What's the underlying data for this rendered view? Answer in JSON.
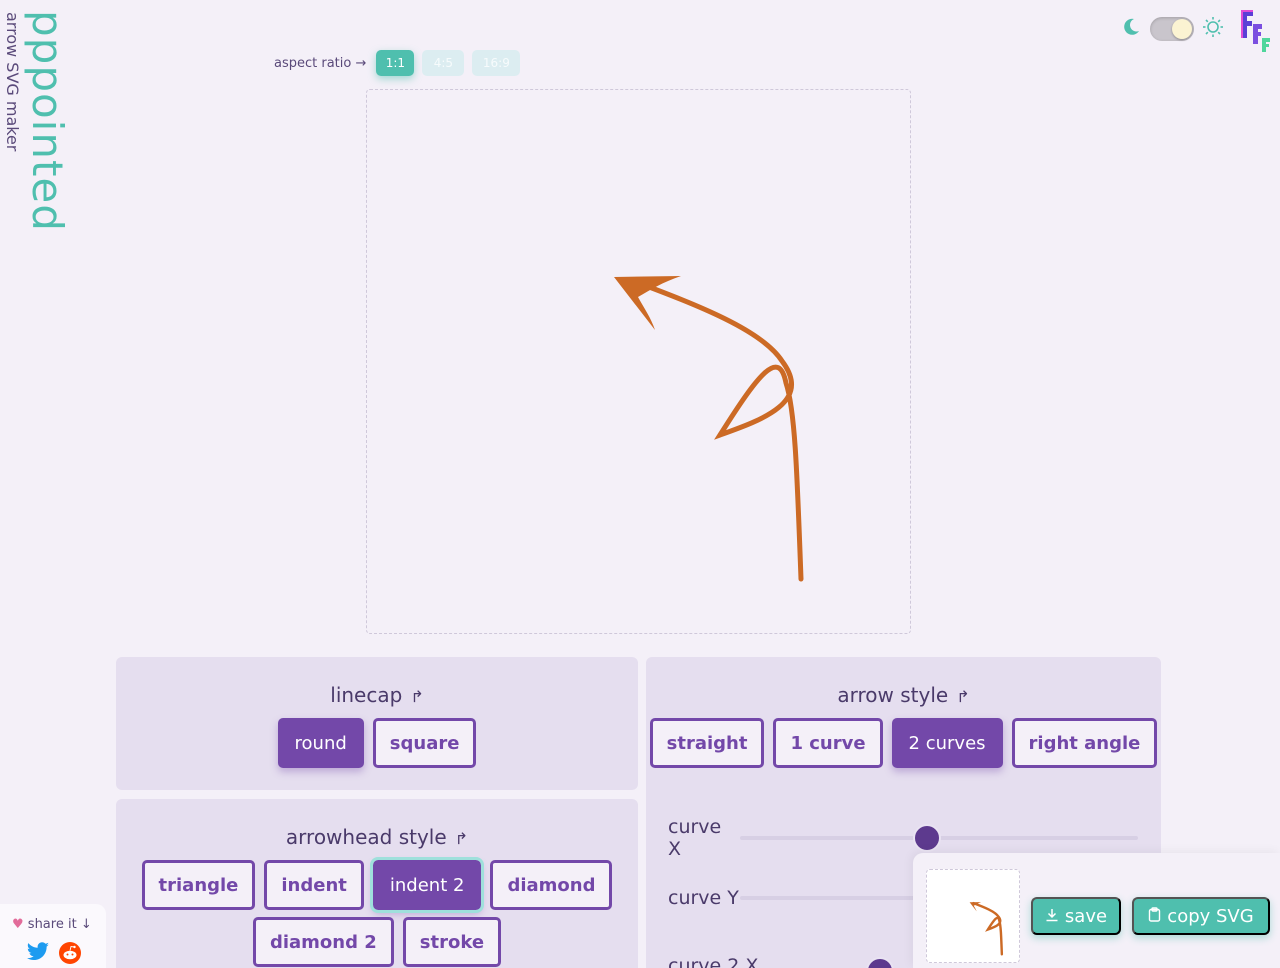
{
  "brand": {
    "title": "pppointed",
    "subtitle": "arrow SVG maker"
  },
  "aspect": {
    "label": "aspect ratio →",
    "options": [
      {
        "label": "1:1",
        "selected": true
      },
      {
        "label": "4:5",
        "selected": false
      },
      {
        "label": "16:9",
        "selected": false
      }
    ]
  },
  "theme": {
    "moon_icon": "moon-icon",
    "sun_icon": "sun-icon",
    "mode": "light"
  },
  "linecap": {
    "title": "linecap",
    "options": [
      {
        "label": "round",
        "selected": true
      },
      {
        "label": "square",
        "selected": false
      }
    ]
  },
  "arrowhead": {
    "title": "arrowhead style",
    "options": [
      {
        "label": "triangle",
        "selected": false
      },
      {
        "label": "indent",
        "selected": false
      },
      {
        "label": "indent 2",
        "selected": true
      },
      {
        "label": "diamond",
        "selected": false
      },
      {
        "label": "diamond 2",
        "selected": false
      },
      {
        "label": "stroke",
        "selected": false
      }
    ]
  },
  "arrow_style": {
    "title": "arrow style",
    "options": [
      {
        "label": "straight",
        "selected": false
      },
      {
        "label": "1 curve",
        "selected": false
      },
      {
        "label": "2 curves",
        "selected": true
      },
      {
        "label": "right angle",
        "selected": false
      }
    ],
    "sliders": [
      {
        "label": "curve X",
        "value": 0.47
      },
      {
        "label": "curve Y"
      },
      {
        "label": "curve 2 X"
      }
    ]
  },
  "export": {
    "save": "save",
    "copy": "copy SVG"
  },
  "share": {
    "label": "share it",
    "icons": [
      "twitter-icon",
      "reddit-icon"
    ]
  },
  "colors": {
    "accent": "#4fbfae",
    "purple": "#7348a9",
    "arrow": "#cc6a25"
  }
}
